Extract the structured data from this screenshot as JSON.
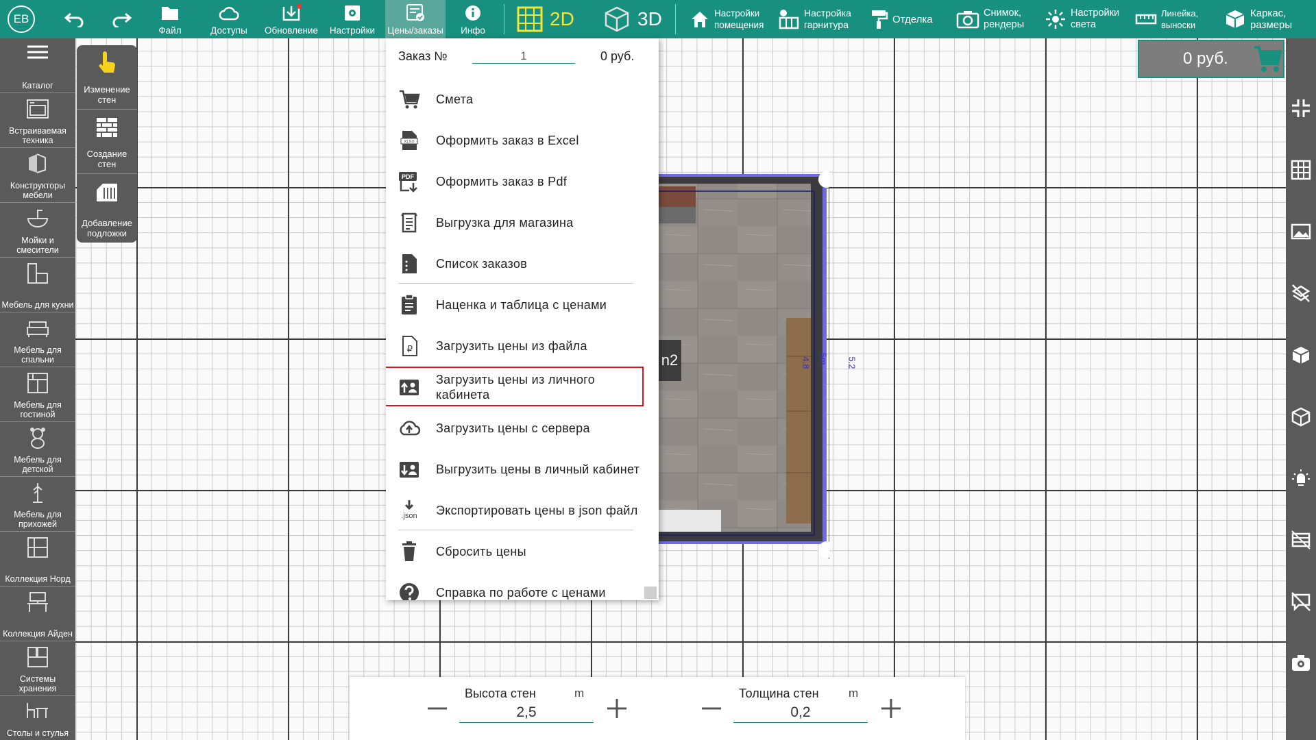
{
  "toolbar": {
    "avatar_initials": "ЕВ",
    "items": [
      {
        "label": "Файл",
        "icon": "folder-icon"
      },
      {
        "label": "Доступы",
        "icon": "cloud-icon"
      },
      {
        "label": "Обновление",
        "icon": "download-icon"
      },
      {
        "label": "Настройки",
        "icon": "settings-icon"
      },
      {
        "label": "Цены/заказы",
        "icon": "price-list-icon"
      },
      {
        "label": "Инфо",
        "icon": "info-icon"
      }
    ],
    "view_2d": "2D",
    "view_3d": "3D",
    "room_settings": "Настройки\nпомещения",
    "set_settings": "Настройка\nгарнитура",
    "finishing": "Отделка",
    "snapshot": "Снимок,\nрендеры",
    "light_settings": "Настройки\nсвета",
    "ruler": "Линейка,\nвыноски",
    "frame": "Каркас,\nразмеры",
    "accent_color": "#17907f"
  },
  "left_sidebar": [
    {
      "label": "Каталог",
      "icon": "menu-icon"
    },
    {
      "label": "Встраиваемая техника",
      "icon": "oven-icon"
    },
    {
      "label": "Конструкторы мебели",
      "icon": "cabinet-builder-icon"
    },
    {
      "label": "Мойки и смесители",
      "icon": "sink-icon"
    },
    {
      "label": "Мебель для кухни",
      "icon": "kitchen-icon"
    },
    {
      "label": "Мебель для спальни",
      "icon": "bed-icon"
    },
    {
      "label": "Мебель для гостиной",
      "icon": "living-room-icon"
    },
    {
      "label": "Мебель для детской",
      "icon": "teddy-bear-icon"
    },
    {
      "label": "Мебель для прихожей",
      "icon": "coat-rack-icon"
    },
    {
      "label": "Коллекция Норд",
      "icon": "shelf-icon"
    },
    {
      "label": "Коллекция Айден",
      "icon": "desk-icon"
    },
    {
      "label": "Системы хранения",
      "icon": "storage-icon"
    },
    {
      "label": "Столы и стулья",
      "icon": "table-chair-icon"
    }
  ],
  "sub_panel": [
    {
      "label": "Изменение стен",
      "icon": "hand-pointer-icon"
    },
    {
      "label": "Создание стен",
      "icon": "brick-wall-icon"
    },
    {
      "label": "Добавление подложки",
      "icon": "add-underlay-icon"
    }
  ],
  "price_box": {
    "value": "0 руб."
  },
  "room": {
    "dim_inner": "4.8",
    "dim_mid": "5m",
    "dim_outer": "5.2",
    "area_fragment": "n2"
  },
  "menu": {
    "order_label": "Заказ №",
    "order_number": "1",
    "order_sum": "0 руб.",
    "items": [
      {
        "label": "Смета",
        "icon": "cart-icon"
      },
      {
        "label": "Оформить заказ в Excel",
        "icon": "xlsx-file-icon"
      },
      {
        "label": "Оформить заказ в Pdf",
        "icon": "pdf-file-icon"
      },
      {
        "label": "Выгрузка для магазина",
        "icon": "shop-export-icon"
      },
      {
        "label": "Список заказов",
        "icon": "order-list-icon"
      },
      {
        "label": "Наценка и таблица с ценами",
        "icon": "clipboard-icon"
      },
      {
        "label": "Загрузить цены из файла",
        "icon": "ruble-file-icon"
      },
      {
        "label": "Загрузить цены из личного кабинета",
        "icon": "upload-account-icon"
      },
      {
        "label": "Загрузить цены с сервера",
        "icon": "cloud-upload-icon"
      },
      {
        "label": "Выгрузить цены в личный кабинет",
        "icon": "download-account-icon"
      },
      {
        "label": "Экспортировать цены в json файл",
        "icon": "json-export-icon"
      },
      {
        "label": "Сбросить цены",
        "icon": "trash-icon"
      },
      {
        "label": "Справка по работе с ценами",
        "icon": "help-icon"
      }
    ],
    "json_icon_text": ".json",
    "xlsx_icon_text": "XLSX",
    "pdf_icon_text": "PDF",
    "ruble_sign": "₽",
    "highlight_color": "#d9141b"
  },
  "wall_panel": {
    "height": {
      "title": "Высота стен",
      "unit": "m",
      "value": "2,5"
    },
    "thickness": {
      "title": "Толщина стен",
      "unit": "m",
      "value": "0,2"
    }
  }
}
